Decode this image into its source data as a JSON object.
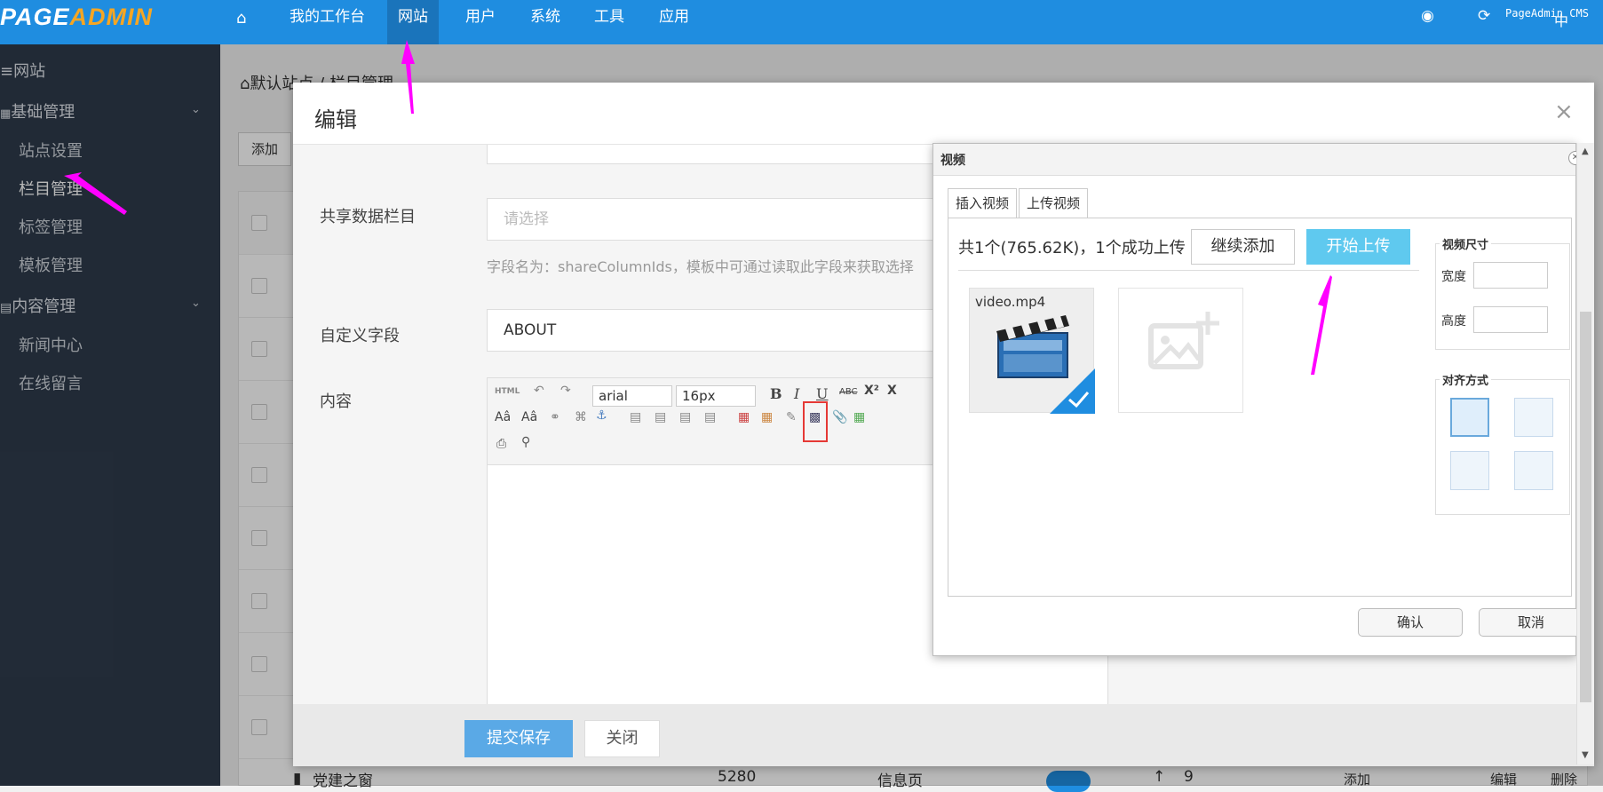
{
  "topbar": {
    "logo_a": "PAGE",
    "logo_b": "ADMIN",
    "nav": [
      "我的工作台",
      "网站",
      "用户",
      "系统",
      "工具",
      "应用"
    ],
    "active_nav": "网站",
    "right_text": "PageAdmin CMS",
    "right_text2": "中"
  },
  "sidebar": {
    "site": "网站",
    "group1": "基础管理",
    "items1": [
      "站点设置",
      "栏目管理",
      "标签管理",
      "模板管理"
    ],
    "group2": "内容管理",
    "items2": [
      "新闻中心",
      "在线留言"
    ]
  },
  "main": {
    "breadcrumb": "默认站点 / 栏目管理",
    "add_button": "添加",
    "bottom_row": {
      "name": "党建之窗",
      "id": "5280",
      "type": "信息页",
      "sort": "9",
      "add": "添加",
      "edit": "编辑",
      "delete": "删除"
    }
  },
  "modal": {
    "title": "编辑",
    "close": "×",
    "field_share_label": "共享数据栏目",
    "field_share_placeholder": "请选择",
    "field_share_hint": "字段名为：shareColumnIds，模板中可通过读取此字段来获取选择",
    "field_custom_label": "自定义字段",
    "field_custom_value": "ABOUT",
    "field_content_label": "内容",
    "editor": {
      "font": "arial",
      "size": "16px",
      "html": "HTML"
    },
    "submit": "提交保存",
    "close_btn": "关闭"
  },
  "video_dialog": {
    "title": "视频",
    "tabs": [
      "插入视频",
      "上传视频"
    ],
    "active_tab": "上传视频",
    "upload_info": "共1个(765.62K)，1个成功上传",
    "continue_btn": "继续添加",
    "start_btn": "开始上传",
    "file_name": "video.mp4",
    "size_legend": "视频尺寸",
    "width_label": "宽度",
    "height_label": "高度",
    "align_legend": "对齐方式",
    "ok": "确认",
    "cancel": "取消"
  },
  "colors": {
    "topbar": "#1f8de0",
    "sidebar": "#2f3b4c",
    "accent": "#5fc9ef",
    "annotation": "#ff00ff"
  }
}
